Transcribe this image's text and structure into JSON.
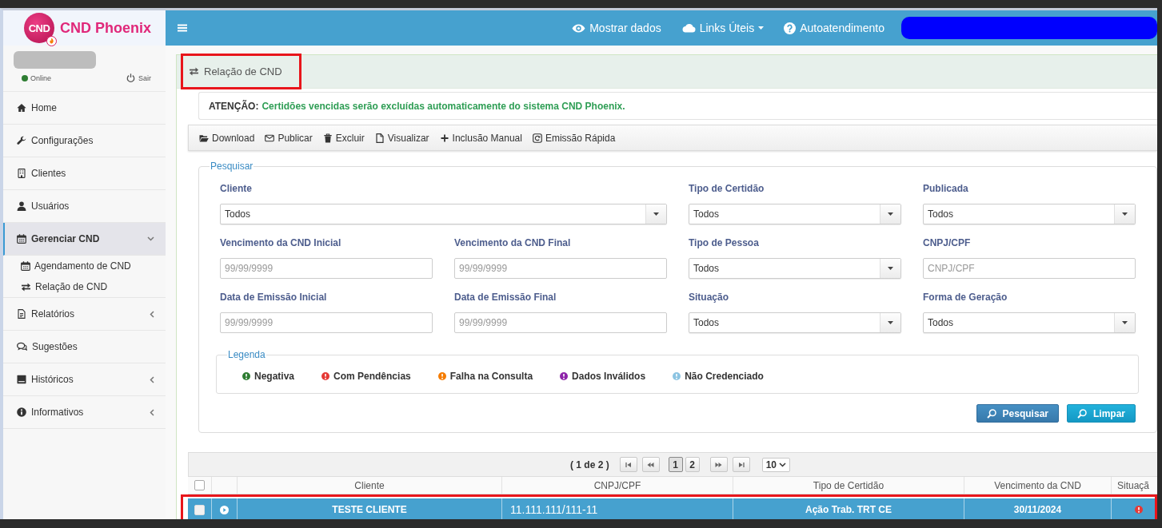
{
  "brand": {
    "logo_text": "CND",
    "name": "CND Phoenix"
  },
  "topbar": {
    "items": [
      {
        "label": "Mostrar dados",
        "has_menu": false
      },
      {
        "label": "Links Úteis",
        "has_menu": true
      },
      {
        "label": "Autoatendimento",
        "has_menu": false
      }
    ]
  },
  "user": {
    "status": "Online",
    "online": true,
    "logout": "Sair"
  },
  "sidebar": {
    "items": [
      {
        "kind": "link",
        "label": "Home",
        "selected": false
      },
      {
        "kind": "link",
        "label": "Configurações",
        "selected": false
      },
      {
        "kind": "link",
        "label": "Clientes",
        "selected": false
      },
      {
        "kind": "link",
        "label": "Usuários",
        "selected": false
      },
      {
        "kind": "group",
        "label": "Gerenciar CND",
        "selected": true,
        "expanded": true,
        "children": [
          {
            "label": "Agendamento de CND",
            "selected": false
          },
          {
            "label": "Relação de CND",
            "selected": false
          }
        ]
      },
      {
        "kind": "group",
        "label": "Relatórios",
        "selected": false,
        "expanded": false
      },
      {
        "kind": "link",
        "label": "Sugestões",
        "selected": false
      },
      {
        "kind": "group",
        "label": "Históricos",
        "selected": false,
        "expanded": false
      },
      {
        "kind": "group",
        "label": "Informativos",
        "selected": false,
        "expanded": false
      }
    ]
  },
  "panel": {
    "title": "Relação de CND",
    "highlighted": true
  },
  "alert": {
    "label": "ATENÇÃO:",
    "message": "Certidões vencidas serão excluídas automaticamente do sistema CND Phoenix."
  },
  "toolbar": {
    "actions": [
      "Download",
      "Publicar",
      "Excluir",
      "Visualizar",
      "Inclusão Manual",
      "Emissão Rápida"
    ]
  },
  "search": {
    "legend": "Pesquisar",
    "rows": [
      [
        {
          "kind": "select",
          "label": "Cliente",
          "value": "Todos"
        },
        "",
        {
          "kind": "select",
          "label": "Tipo de Certidão",
          "value": "Todos"
        },
        {
          "kind": "select",
          "label": "Publicada",
          "value": "Todos"
        }
      ],
      [
        {
          "kind": "input",
          "label": "Vencimento da CND Inicial",
          "placeholder": "99/99/9999"
        },
        {
          "kind": "input",
          "label": "Vencimento da CND Final",
          "placeholder": "99/99/9999"
        },
        {
          "kind": "select",
          "label": "Tipo de Pessoa",
          "value": "Todos"
        },
        {
          "kind": "input",
          "label": "CNPJ/CPF",
          "placeholder": "CNPJ/CPF"
        }
      ],
      [
        {
          "kind": "input",
          "label": "Data de Emissão Inicial",
          "placeholder": "99/99/9999"
        },
        {
          "kind": "input",
          "label": "Data de Emissão Final",
          "placeholder": "99/99/9999"
        },
        {
          "kind": "select",
          "label": "Situação",
          "value": "Todos"
        },
        {
          "kind": "select",
          "label": "Forma de Geração",
          "value": "Todos"
        }
      ]
    ],
    "buttons": [
      {
        "label": "Pesquisar",
        "kind": "primary"
      },
      {
        "label": "Limpar",
        "kind": "info"
      }
    ]
  },
  "legend": {
    "title": "Legenda",
    "items": [
      {
        "label": "Negativa",
        "color": "#2e7d32"
      },
      {
        "label": "Com Pendências",
        "color": "#e53935"
      },
      {
        "label": "Falha na Consulta",
        "color": "#f57c00"
      },
      {
        "label": "Dados Inválidos",
        "color": "#8e24aa"
      },
      {
        "label": "Não Credenciado",
        "color": "#8cc4e2"
      }
    ]
  },
  "pagination": {
    "info": "( 1 de 2 )",
    "pages": [
      {
        "label": "1",
        "selected": true
      },
      {
        "label": "2",
        "selected": false
      }
    ],
    "page_size": "10"
  },
  "table": {
    "header_checked": false,
    "columns": [
      "Cliente",
      "CNPJ/CPF",
      "Tipo de Certidão",
      "Vencimento da CND",
      "Situaçã"
    ],
    "rows": [
      {
        "cells": [
          "TESTE CLIENTE",
          "11.111.111/111-11",
          "Ação Trab. TRT CE",
          "30/11/2024"
        ],
        "checked": false,
        "selected": true,
        "highlighted": true,
        "status": {
          "color": "#e53935"
        }
      }
    ]
  }
}
